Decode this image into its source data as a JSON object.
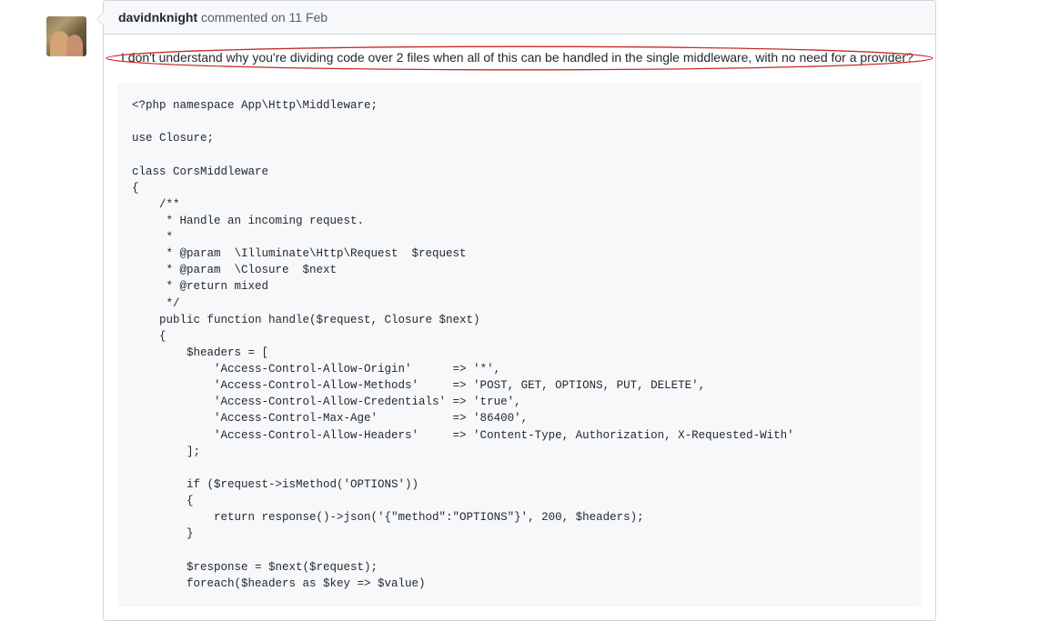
{
  "comment": {
    "author": "davidnknight",
    "action": "commented",
    "timestamp": "on 11 Feb",
    "body_text": "I don't understand why you're dividing code over 2 files when all of this can be handled in the single middleware, with no need for a provider?",
    "code": "<?php namespace App\\Http\\Middleware;\n\nuse Closure;\n\nclass CorsMiddleware\n{\n    /**\n     * Handle an incoming request.\n     *\n     * @param  \\Illuminate\\Http\\Request  $request\n     * @param  \\Closure  $next\n     * @return mixed\n     */\n    public function handle($request, Closure $next)\n    {\n        $headers = [\n            'Access-Control-Allow-Origin'      => '*',\n            'Access-Control-Allow-Methods'     => 'POST, GET, OPTIONS, PUT, DELETE',\n            'Access-Control-Allow-Credentials' => 'true',\n            'Access-Control-Max-Age'           => '86400',\n            'Access-Control-Allow-Headers'     => 'Content-Type, Authorization, X-Requested-With'\n        ];\n\n        if ($request->isMethod('OPTIONS'))\n        {\n            return response()->json('{\"method\":\"OPTIONS\"}', 200, $headers);\n        }\n\n        $response = $next($request);\n        foreach($headers as $key => $value)"
  }
}
